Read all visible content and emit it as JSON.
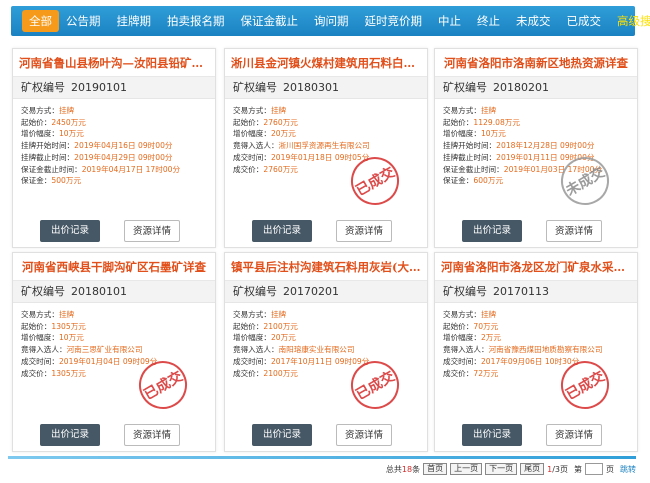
{
  "nav": {
    "items": [
      "全部",
      "公告期",
      "挂牌期",
      "拍卖报名期",
      "保证金截止",
      "询问期",
      "延时竞价期",
      "中止",
      "终止",
      "未成交",
      "已成交"
    ],
    "advanced": "高级搜索"
  },
  "common": {
    "code_label": "矿权编号",
    "bid_button": "出价记录",
    "detail_button": "资源详情"
  },
  "cards": [
    {
      "title": "河南省鲁山县杨叶沟—汝阳县铅矿详查",
      "code": "20190101",
      "rows": [
        {
          "k": "交易方式：",
          "v": "挂牌"
        },
        {
          "k": "起始价：",
          "v": "2450万元"
        },
        {
          "k": "增价幅度：",
          "v": "10万元"
        },
        {
          "k": "挂牌开始时间：",
          "v": "2019年04月16日 09时00分"
        },
        {
          "k": "挂牌截止时间：",
          "v": "2019年04月29日 09时00分"
        },
        {
          "k": "保证金截止时间：",
          "v": "2019年04月17日 17时00分"
        },
        {
          "k": "保证金：",
          "v": "500万元"
        }
      ],
      "stamp": ""
    },
    {
      "title": "淅川县金河镇火煤村建筑用石料白云岩矿",
      "code": "20180301",
      "rows": [
        {
          "k": "交易方式：",
          "v": "挂牌"
        },
        {
          "k": "起始价：",
          "v": "2760万元"
        },
        {
          "k": "增价幅度：",
          "v": "20万元"
        },
        {
          "k": "竟得入选人：",
          "v": "淅川国孚资源再生有限公司"
        },
        {
          "k": "成交时间：",
          "v": "2019年01月18日 09时05分"
        },
        {
          "k": "成交价：",
          "v": "2760万元"
        }
      ],
      "stamp": "已成交"
    },
    {
      "title": "河南省洛阳市洛南新区地热资源详查",
      "code": "20180201",
      "rows": [
        {
          "k": "交易方式：",
          "v": "挂牌"
        },
        {
          "k": "起始价：",
          "v": "1129.08万元"
        },
        {
          "k": "增价幅度：",
          "v": "10万元"
        },
        {
          "k": "挂牌开始时间：",
          "v": "2018年12月28日 09时00分"
        },
        {
          "k": "挂牌截止时间：",
          "v": "2019年01月11日 09时00分"
        },
        {
          "k": "保证金截止时间：",
          "v": "2019年01月03日 17时00分"
        },
        {
          "k": "保证金：",
          "v": "600万元"
        }
      ],
      "stamp": "未成交"
    },
    {
      "title": "河南省西峡县干脚沟矿区石墨矿详查",
      "code": "20180101",
      "rows": [
        {
          "k": "交易方式：",
          "v": "挂牌"
        },
        {
          "k": "起始价：",
          "v": "1305万元"
        },
        {
          "k": "增价幅度：",
          "v": "10万元"
        },
        {
          "k": "竟得入选人：",
          "v": "河南三思矿业有限公司"
        },
        {
          "k": "成交时间：",
          "v": "2019年01月04日 09时09分"
        },
        {
          "k": "成交价：",
          "v": "1305万元"
        }
      ],
      "stamp": "已成交"
    },
    {
      "title": "镇平县后注村沟建筑石料用灰岩(大理岩)矿",
      "code": "20170201",
      "rows": [
        {
          "k": "交易方式：",
          "v": "挂牌"
        },
        {
          "k": "起始价：",
          "v": "2100万元"
        },
        {
          "k": "增价幅度：",
          "v": "20万元"
        },
        {
          "k": "竟得入选人：",
          "v": "南阳瑢康实业有限公司"
        },
        {
          "k": "成交时间：",
          "v": "2017年10月11日 09时09分"
        },
        {
          "k": "成交价：",
          "v": "2100万元"
        }
      ],
      "stamp": "已成交"
    },
    {
      "title": "河南省洛阳市洛龙区龙门矿泉水采矿权",
      "code": "20170113",
      "rows": [
        {
          "k": "交易方式：",
          "v": "挂牌"
        },
        {
          "k": "起始价：",
          "v": "70万元"
        },
        {
          "k": "增价幅度：",
          "v": "2万元"
        },
        {
          "k": "竟得入选人：",
          "v": "河南省豫西煤田地质勘察有限公司"
        },
        {
          "k": "成交时间：",
          "v": "2017年09月06日 10时30分"
        },
        {
          "k": "成交价：",
          "v": "72万元"
        }
      ],
      "stamp": "已成交"
    }
  ],
  "pager": {
    "total_prefix": "总共",
    "total_count": "18",
    "total_suffix": "条",
    "first": "首页",
    "prev": "上一页",
    "next": "下一页",
    "last": "尾页",
    "page_current": "1",
    "page_total": "/3页",
    "jump_prefix": "第",
    "jump_suffix": "页",
    "go": "跳转"
  }
}
